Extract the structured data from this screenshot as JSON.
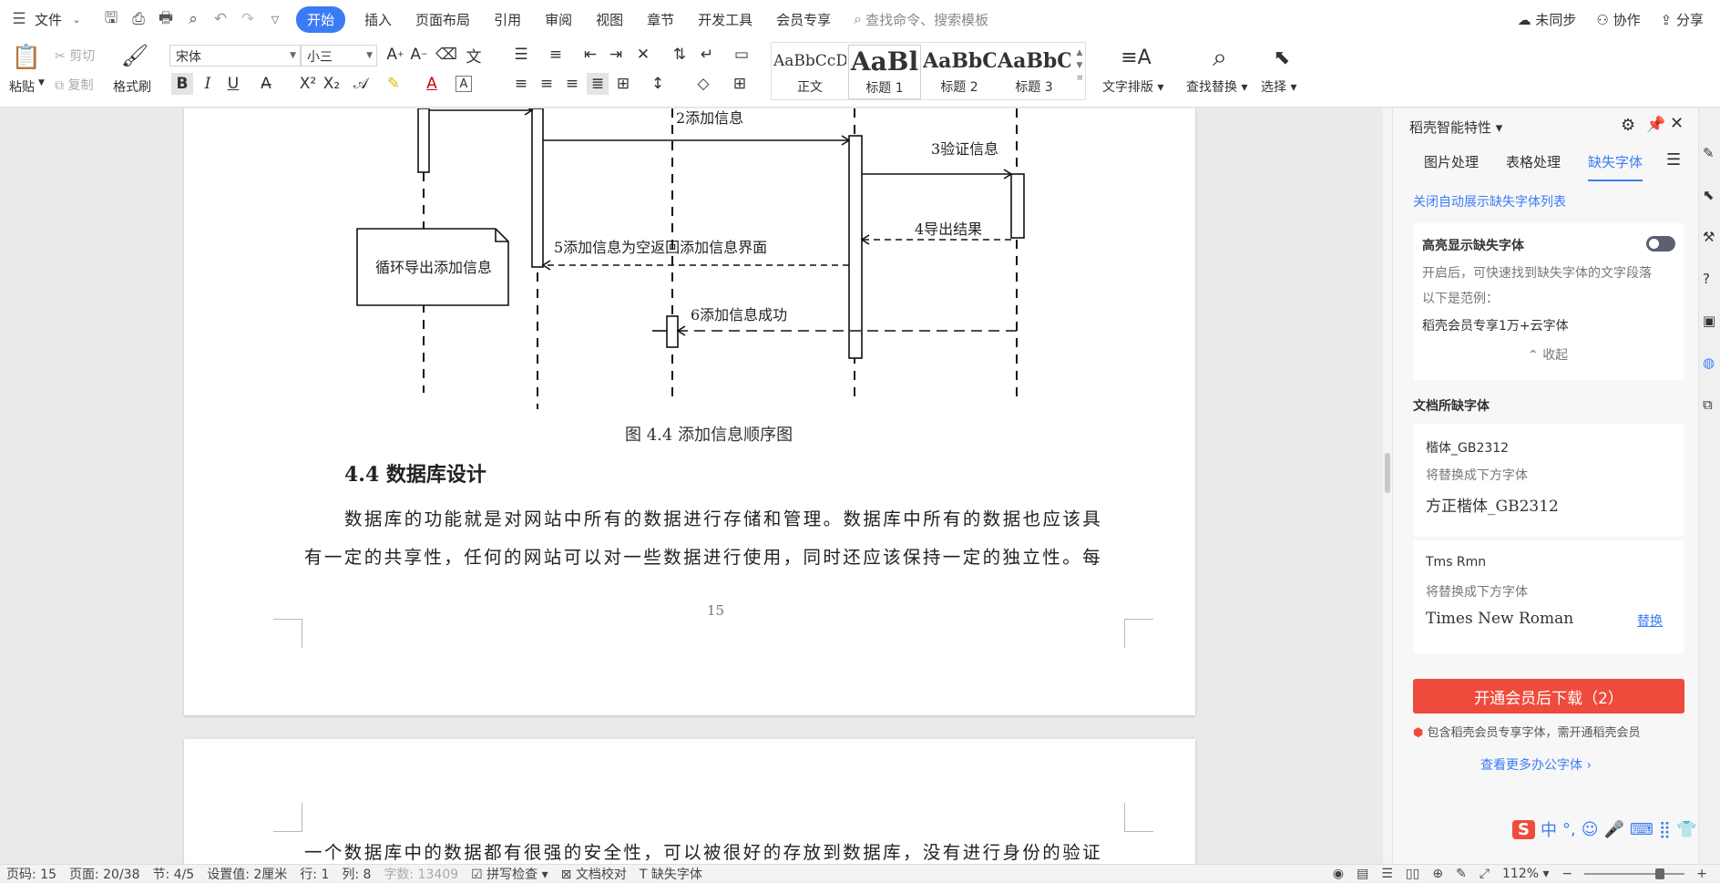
{
  "menubar": {
    "file": "文件",
    "tabs": [
      "开始",
      "插入",
      "页面布局",
      "引用",
      "审阅",
      "视图",
      "章节",
      "开发工具",
      "会员专享"
    ],
    "search_placeholder": "查找命令、搜索模板",
    "sync": "未同步",
    "collab": "协作",
    "share": "分享"
  },
  "ribbon": {
    "paste": "粘贴",
    "cut": "剪切",
    "copy": "复制",
    "format_painter": "格式刷",
    "font_name": "宋体",
    "font_size": "小三",
    "styles": [
      {
        "sample": "AaBbCcD",
        "name": "正文"
      },
      {
        "sample": "AaBl",
        "name": "标题 1"
      },
      {
        "sample": "AaBbC",
        "name": "标题 2"
      },
      {
        "sample": "AaBbC",
        "name": "标题 3"
      }
    ],
    "text_layout": "文字排版",
    "find_replace": "查找替换",
    "select": "选择"
  },
  "document": {
    "diagram": {
      "msg2": "2添加信息",
      "msg3": "3验证信息",
      "msg4": "4导出结果",
      "msg5": "5添加信息为空返回添加信息界面",
      "msg6": "6添加信息成功",
      "note": "循环导出添加信息"
    },
    "caption": "图 4.4  添加信息顺序图",
    "heading": "4.4  数据库设计",
    "para_line1": "数据库的功能就是对网站中所有的数据进行存储和管理。数据库中所有的数据也应该具",
    "para_line2": "有一定的共享性，任何的网站可以对一些数据进行使用，同时还应该保持一定的独立性。每",
    "page_number": "15",
    "page2_line": "一个数据库中的数据都有很强的安全性，可以被很好的存放到数据库，没有进行身份的验证"
  },
  "panel": {
    "title": "稻壳智能特性",
    "tabs": [
      "图片处理",
      "表格处理",
      "缺失字体"
    ],
    "auto_show_link": "关闭自动展示缺失字体列表",
    "highlight_title": "高亮显示缺失字体",
    "highlight_desc": "开启后，可快速找到缺失字体的文字段落",
    "example_label": "以下是范例：",
    "example_value": "稻壳会员专享1万+云字体",
    "collapse": "收起",
    "missing_title": "文档所缺字体",
    "font1_name": "楷体_GB2312",
    "replace_label": "将替换成下方字体",
    "font1_replacement": "方正楷体_GB2312",
    "font2_name": "Tms Rmn",
    "font2_replacement": "Times New Roman",
    "replace_link": "替换",
    "buy_button": "开通会员后下载（2）",
    "member_note": "包含稻壳会员专享字体，需开通稻壳会员",
    "more_fonts": "查看更多办公字体"
  },
  "statusbar": {
    "page": "页码: 15",
    "pages": "页面: 20/38",
    "section": "节: 4/5",
    "setting": "设置值: 2厘米",
    "row": "行: 1",
    "col": "列: 8",
    "wordcount": "字数: 13409",
    "spellcheck": "拼写检查",
    "doccheck": "文档校对",
    "missing_font": "缺失字体",
    "zoom": "112%"
  },
  "ime": {
    "label": "中"
  }
}
